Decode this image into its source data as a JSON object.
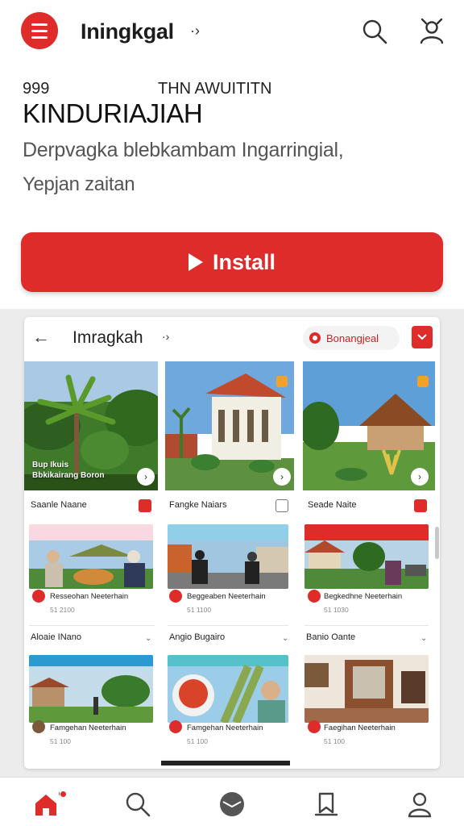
{
  "header": {
    "title": "Iningkgal",
    "title_suffix": "·›",
    "icons": {
      "menu": "menu-icon",
      "search": "search-icon",
      "profile": "user-icon"
    }
  },
  "hero": {
    "small_left": "999",
    "small_right": "THN AWUITITN",
    "title": "KINDURIAJIAH",
    "description": "Derpvagka blebkambam Ingarringial,",
    "sub": "Yepjan zaitan"
  },
  "install": {
    "label": "Install"
  },
  "preview": {
    "title": "Imragkah",
    "title_suffix": "·›",
    "pill_label": "Bonangjeal",
    "cards": [
      {
        "title": "Saanle Naane",
        "overlay_line1": "Bup Ikuis",
        "overlay_line2": "Bbkikairang Boron"
      },
      {
        "title": "Fangke Naiars"
      },
      {
        "title": "Seade Naite"
      }
    ],
    "mini_row1": [
      {
        "caption": "Resseohan Neeterhain",
        "sub": "51 2100"
      },
      {
        "caption": "Beggeaben Neeterhain",
        "sub": "51 1100"
      },
      {
        "caption": "Begkedhne Neeterhain",
        "sub": "51 1030"
      }
    ],
    "sections": [
      {
        "label": "Aloaie INano"
      },
      {
        "label": "Angio Bugairo"
      },
      {
        "label": "Banio Oante"
      }
    ],
    "mini_row2": [
      {
        "caption": "Famgehan Neeterhain",
        "sub": "51 100"
      },
      {
        "caption": "Famgehan Neeterhain",
        "sub": "51 100"
      },
      {
        "caption": "Faegihan Neeterhain",
        "sub": "51 100"
      }
    ]
  },
  "bottom_nav": {
    "items": [
      "home-icon",
      "search-icon",
      "inbox-icon",
      "bookmark-icon",
      "profile-icon"
    ]
  },
  "colors": {
    "accent": "#dd2c2a",
    "background": "#ffffff",
    "section_bg": "#ececec"
  }
}
